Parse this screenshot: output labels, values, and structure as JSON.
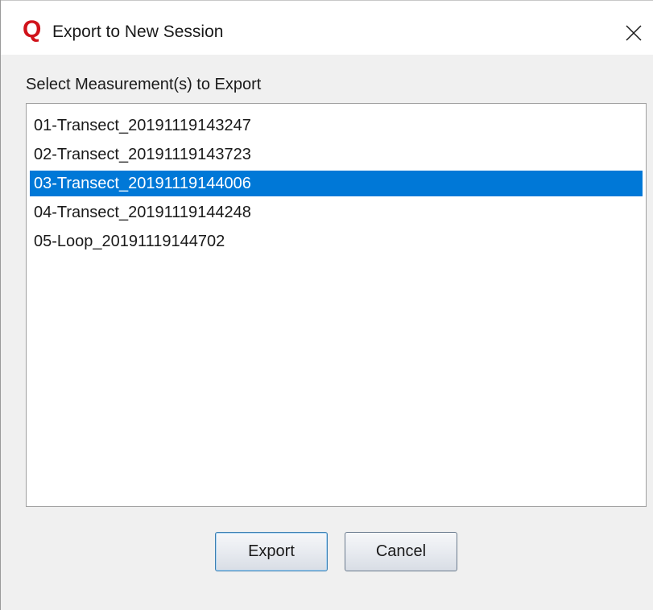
{
  "window": {
    "title": "Export to New Session",
    "app_icon_glyph": "Q",
    "app_icon_color": "#d0131b"
  },
  "dialog": {
    "prompt": "Select Measurement(s) to Export",
    "items": [
      {
        "label": "01-Transect_20191119143247",
        "selected": false
      },
      {
        "label": "02-Transect_20191119143723",
        "selected": false
      },
      {
        "label": "03-Transect_20191119144006",
        "selected": true
      },
      {
        "label": "04-Transect_20191119144248",
        "selected": false
      },
      {
        "label": "05-Loop_20191119144702",
        "selected": false
      }
    ],
    "selection_color": "#0078d7"
  },
  "buttons": {
    "export_label": "Export",
    "cancel_label": "Cancel"
  }
}
